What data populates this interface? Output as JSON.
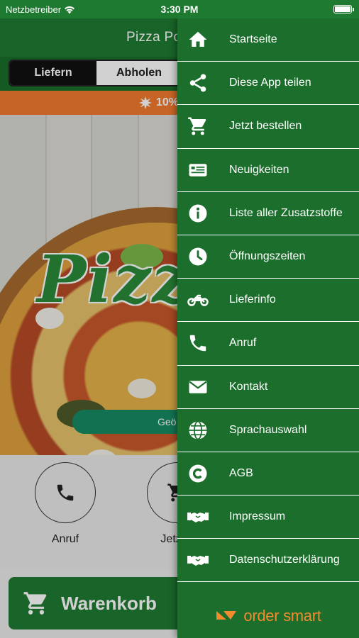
{
  "status_bar": {
    "carrier": "Netzbetreiber",
    "time": "3:30 PM"
  },
  "header": {
    "title": "Pizza Po"
  },
  "order_mode": {
    "options": [
      "Liefern",
      "Abholen"
    ],
    "selected": "Liefern"
  },
  "promo": {
    "text": "10%"
  },
  "hero": {
    "logo_text": "Pizza",
    "button_label": "Geö"
  },
  "actions": [
    {
      "label": "Anruf",
      "icon": "phone-icon"
    },
    {
      "label": "Jetzt b",
      "icon": "cart-icon"
    }
  ],
  "cart": {
    "label": "Warenkorb"
  },
  "menu": {
    "items": [
      {
        "label": "Startseite",
        "icon": "home-icon"
      },
      {
        "label": "Diese App teilen",
        "icon": "share-icon"
      },
      {
        "label": "Jetzt bestellen",
        "icon": "cart-icon"
      },
      {
        "label": "Neuigkeiten",
        "icon": "news-icon"
      },
      {
        "label": "Liste aller Zusatzstoffe",
        "icon": "info-icon"
      },
      {
        "label": "Öffnungszeiten",
        "icon": "clock-icon"
      },
      {
        "label": "Lieferinfo",
        "icon": "motorcycle-icon"
      },
      {
        "label": "Anruf",
        "icon": "phone-icon"
      },
      {
        "label": "Kontakt",
        "icon": "envelope-icon"
      },
      {
        "label": "Sprachauswahl",
        "icon": "globe-icon"
      },
      {
        "label": "AGB",
        "icon": "copyright-icon"
      },
      {
        "label": "Impressum",
        "icon": "handshake-icon"
      },
      {
        "label": "Datenschutzerklärung",
        "icon": "handshake-icon"
      }
    ]
  },
  "brand": {
    "name": "order smart"
  },
  "colors": {
    "primary_green": "#1b6e2b",
    "accent_orange": "#f27a2e",
    "brand_orange": "#f28a2e"
  }
}
